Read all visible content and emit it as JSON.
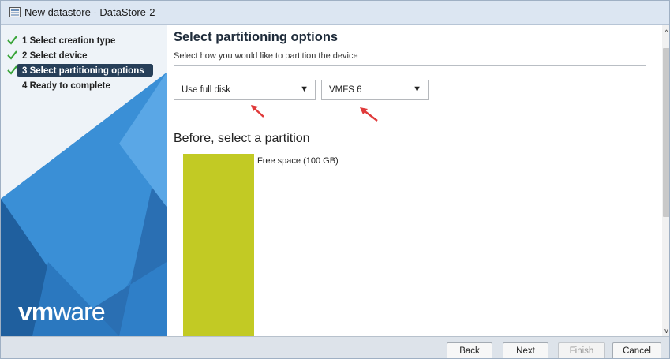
{
  "window": {
    "title": "New datastore - DataStore-2"
  },
  "sidebar": {
    "steps": [
      {
        "label": "1 Select creation type",
        "state": "done"
      },
      {
        "label": "2 Select device",
        "state": "done"
      },
      {
        "label": "3 Select partitioning options",
        "state": "active"
      },
      {
        "label": "4 Ready to complete",
        "state": "pending"
      }
    ],
    "logo": {
      "bold": "vm",
      "rest": "ware"
    }
  },
  "main": {
    "heading": "Select partitioning options",
    "subheading": "Select how you would like to partition the device",
    "partition_select": {
      "value": "Use full disk",
      "icon": "caret-down-icon"
    },
    "fs_select": {
      "value": "VMFS 6",
      "icon": "caret-down-icon"
    },
    "section_title": "Before, select a partition",
    "partition_block": {
      "label": "Free space  (100 GB)",
      "color": "#c2ca24"
    }
  },
  "footer": {
    "back": "Back",
    "next": "Next",
    "finish": "Finish",
    "cancel": "Cancel"
  },
  "colors": {
    "active_step_bg": "#273f59",
    "check": "#3aa53a",
    "annotation_arrow": "#e03a3a"
  }
}
